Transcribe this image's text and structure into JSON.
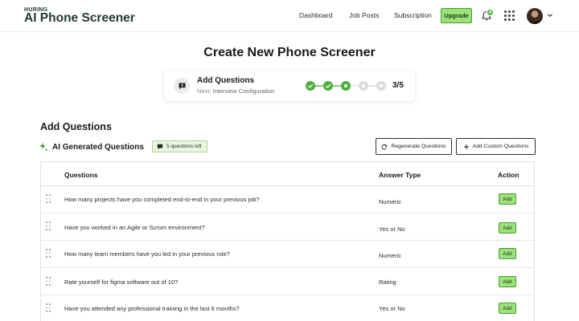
{
  "brand": {
    "small": "HURING",
    "big": "AI Phone Screener"
  },
  "nav": {
    "dashboard": "Dashboard",
    "job_posts": "Job Posts",
    "subscription": "Subscription",
    "upgrade": "Upgrade",
    "notification_count": "4"
  },
  "page": {
    "title": "Create New Phone Screener"
  },
  "stepper": {
    "title": "Add Questions",
    "next_prefix": "Next:",
    "next_label": "Interview Configuration",
    "count": "3/5",
    "steps_completed": 2,
    "current_step": 3,
    "total_steps": 5
  },
  "section": {
    "title": "Add Questions",
    "ai_title": "AI Generated Questions",
    "questions_left": "5 questions left",
    "regenerate": "Regenerate Questions",
    "add_custom": "Add Custom Questions"
  },
  "table": {
    "headers": {
      "questions": "Questions",
      "answer_type": "Answer Type",
      "action": "Action"
    },
    "rows": [
      {
        "question": "How many projects have you completed end-to-end in your previous job?",
        "answer_type": "Numeric",
        "action": "Add"
      },
      {
        "question": "Have you worked in an Agile or Scrum environment?",
        "answer_type": "Yes or No",
        "action": "Add"
      },
      {
        "question": "How many team members have you led in your previous role?",
        "answer_type": "Numeric",
        "action": "Add"
      },
      {
        "question": "Rate yourself  for figma software out of 10?",
        "answer_type": "Rating",
        "action": "Add"
      },
      {
        "question": "Have you attended any professional training in the last 6 months?",
        "answer_type": "Yes or No",
        "action": "Add"
      }
    ]
  },
  "colors": {
    "brand_green": "#9be27a",
    "brand_green_border": "#4c9a33",
    "step_green": "#4caf3a",
    "step_pending": "#dcdcdc",
    "text_dark": "#213b2b"
  },
  "icons": [
    "bell-icon",
    "apps-grid-icon",
    "avatar",
    "chevron-down-icon",
    "chat-bubble-icon",
    "check-icon",
    "sparkle-icon",
    "refresh-icon",
    "plus-icon",
    "drag-handle-icon"
  ]
}
